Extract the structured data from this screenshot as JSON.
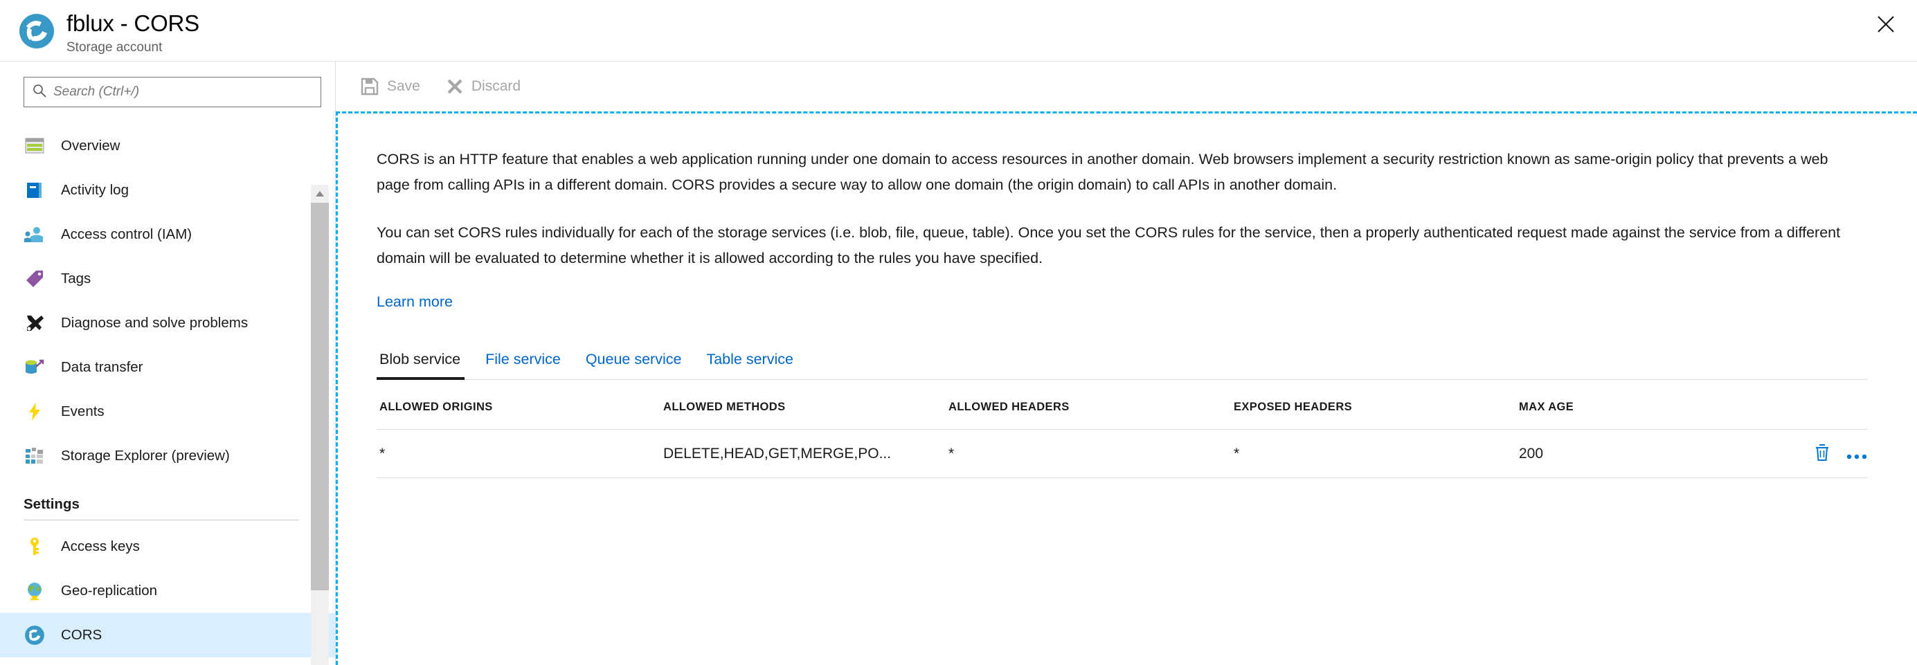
{
  "header": {
    "title": "fblux - CORS",
    "subtitle": "Storage account",
    "resource_icon": "storage-account-icon",
    "close_label": "Close",
    "close_icon": "close-icon"
  },
  "sidebar": {
    "search": {
      "placeholder": "Search (Ctrl+/)",
      "value": "",
      "icon": "search-icon"
    },
    "collapse_icon": "chevron-double-left-icon",
    "items": [
      {
        "label": "Overview",
        "icon": "overview-icon",
        "selected": false
      },
      {
        "label": "Activity log",
        "icon": "activity-log-icon",
        "selected": false
      },
      {
        "label": "Access control (IAM)",
        "icon": "access-control-icon",
        "selected": false
      },
      {
        "label": "Tags",
        "icon": "tags-icon",
        "selected": false
      },
      {
        "label": "Diagnose and solve problems",
        "icon": "diagnose-icon",
        "selected": false
      },
      {
        "label": "Data transfer",
        "icon": "data-transfer-icon",
        "selected": false
      },
      {
        "label": "Events",
        "icon": "events-icon",
        "selected": false
      },
      {
        "label": "Storage Explorer (preview)",
        "icon": "storage-explorer-icon",
        "selected": false
      }
    ],
    "settings_section": {
      "title": "Settings",
      "items": [
        {
          "label": "Access keys",
          "icon": "key-icon",
          "selected": false
        },
        {
          "label": "Geo-replication",
          "icon": "globe-icon",
          "selected": false
        },
        {
          "label": "CORS",
          "icon": "cors-icon",
          "selected": true
        }
      ]
    }
  },
  "toolbar": {
    "save_label": "Save",
    "save_icon": "save-icon",
    "discard_label": "Discard",
    "discard_icon": "discard-icon"
  },
  "main": {
    "paragraph1": "CORS is an HTTP feature that enables a web application running under one domain to access resources in another domain. Web browsers implement a security restriction known as same-origin policy that prevents a web page from calling APIs in a different domain. CORS provides a secure way to allow one domain (the origin domain) to call APIs in another domain.",
    "paragraph2": "You can set CORS rules individually for each of the storage services (i.e. blob, file, queue, table). Once you set the CORS rules for the service, then a properly authenticated request made against the service from a different domain will be evaluated to determine whether it is allowed according to the rules you have specified.",
    "learn_more": "Learn more",
    "tabs": [
      {
        "label": "Blob service",
        "active": true
      },
      {
        "label": "File service",
        "active": false
      },
      {
        "label": "Queue service",
        "active": false
      },
      {
        "label": "Table service",
        "active": false
      }
    ],
    "table": {
      "columns": [
        "ALLOWED ORIGINS",
        "ALLOWED METHODS",
        "ALLOWED HEADERS",
        "EXPOSED HEADERS",
        "MAX AGE"
      ],
      "rows": [
        {
          "allowed_origins": "*",
          "allowed_methods": "DELETE,HEAD,GET,MERGE,PO...",
          "allowed_headers": "*",
          "exposed_headers": "*",
          "max_age": "200",
          "delete_icon": "trash-icon",
          "more_icon": "ellipsis-icon"
        }
      ]
    }
  },
  "colors": {
    "accent_link": "#0066cc",
    "selected_row": "#d9eeff",
    "action_blue": "#0078d4",
    "focus_border": "#00b0f0",
    "disabled_text": "#a6a6a6"
  }
}
